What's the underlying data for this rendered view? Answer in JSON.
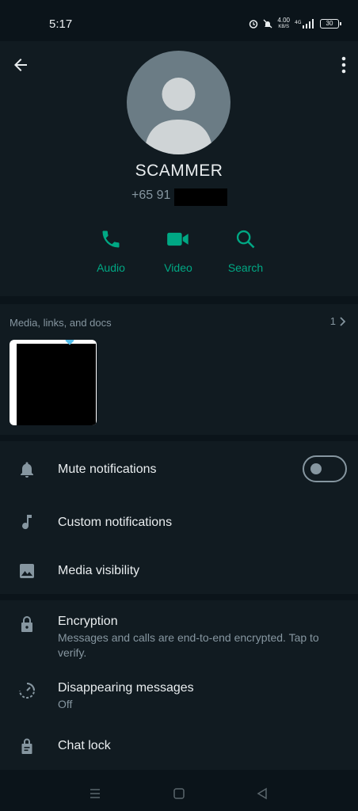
{
  "status_bar": {
    "time": "5:17",
    "net_speed_top": "4.00",
    "net_speed_unit": "KB/S",
    "battery": "30"
  },
  "contact": {
    "name": "SCAMMER",
    "phone_prefix": "+65 91"
  },
  "actions": {
    "audio": "Audio",
    "video": "Video",
    "search": "Search"
  },
  "media": {
    "label": "Media, links, and docs",
    "count": "1"
  },
  "settings": {
    "mute": "Mute notifications",
    "custom": "Custom notifications",
    "visibility": "Media visibility"
  },
  "privacy": {
    "encryption_title": "Encryption",
    "encryption_desc": "Messages and calls are end-to-end encrypted. Tap to verify.",
    "disappearing_title": "Disappearing messages",
    "disappearing_value": "Off",
    "chat_lock": "Chat lock"
  },
  "colors": {
    "accent": "#00a884",
    "background": "#0b141a",
    "surface": "#111b21",
    "secondary_text": "#8696a0"
  },
  "icons": [
    "back-arrow-icon",
    "more-vert-icon",
    "phone-icon",
    "video-camera-icon",
    "search-icon",
    "chevron-right-icon",
    "bell-icon",
    "music-note-icon",
    "image-icon",
    "lock-icon",
    "timer-icon",
    "chat-lock-icon",
    "recent-apps-icon",
    "home-icon",
    "back-triangle-icon"
  ]
}
